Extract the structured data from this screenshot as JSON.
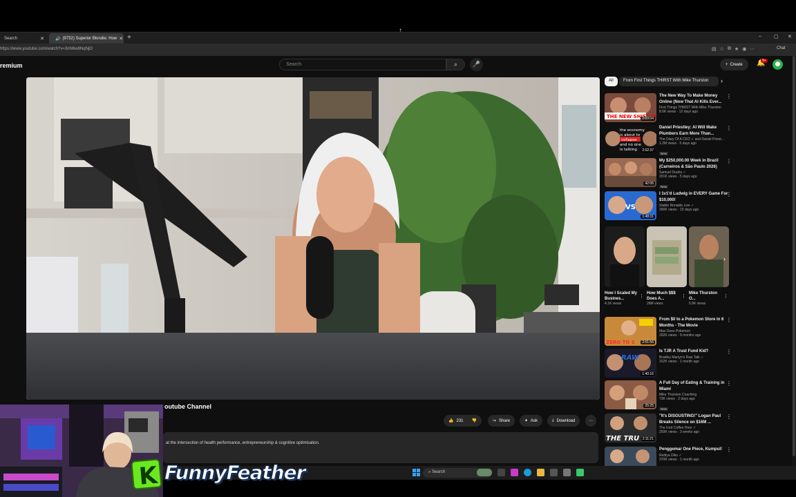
{
  "browser": {
    "tabs": [
      {
        "label": "Search"
      },
      {
        "label": "(9732) Superior Blondie: How"
      }
    ],
    "new_tab_glyph": "+",
    "url": "https://www.youtube.com/watch?v=3nN6w8NqNjO",
    "chat_label": "Chat",
    "window_controls": [
      "–",
      "▢",
      "✕"
    ]
  },
  "youtube": {
    "brand_fragment": "remium",
    "search_placeholder": "Search",
    "create_label": "Create",
    "notification_count": "9+",
    "video": {
      "title_fragment": "outube Channel",
      "actions": {
        "likes": "231",
        "share": "Share",
        "ask": "Ask",
        "download": "Download",
        "more": "⋯"
      },
      "description": "at the intersection of health performance, entrepreneurship & cognitive optimisation."
    },
    "sidebar": {
      "chips": {
        "all": "All",
        "from": "From First Things THIRST With Mike Thurston"
      },
      "videos_top": [
        {
          "title": "The New Way To Make Money Online (Now That AI Kills Ever...",
          "channel": "First Things THIRST With Mike Thurston",
          "stats": "8.6K views · 12 days ago",
          "duration": "2:09:04",
          "new": "",
          "thumb_text": "THE NEW SHIFT IS HE"
        },
        {
          "title": "Daniel Priestley: AI Will Make Plumbers Earn More Than...",
          "channel": "The Diary Of A CEO ✓ and Daniel Priest...",
          "stats": "1.2M views · 5 days ago",
          "duration": "2:02:37",
          "new": "New",
          "thumb_text": "the economy is about to collapse and no one is talking about it"
        },
        {
          "title": "My $250,000.00 Week in Brazil (Carneiros & São Paulo 2026)",
          "channel": "Samuel Douha ✓",
          "stats": "201K views · 5 days ago",
          "duration": "42:06",
          "new": "New",
          "thumb_text": ""
        },
        {
          "title": "I 1v1'd Ludwig in EVERY Game For $10,000!",
          "channel": "Stable Ronaldo Live ✓",
          "stats": "300K views · 10 days ago",
          "duration": "1:48:31",
          "new": "",
          "thumb_text": "VS"
        }
      ],
      "shorts": [
        {
          "title": "How I Scaled My Busines...",
          "views": "4.1K views"
        },
        {
          "title": "How Much $$$ Does A...",
          "views": "28M views"
        },
        {
          "title": "Mike Thurston O...",
          "views": "5.9K views"
        }
      ],
      "videos_bottom": [
        {
          "title": "From $0 to a Pokemon Store in 6 Months - The Movie",
          "channel": "Max Does Pokemon",
          "stats": "292K views · 9 months ago",
          "duration": "2:01:56",
          "new": "",
          "thumb_text": "ZERO TO S"
        },
        {
          "title": "Is TJR A Trust Fund Kid?",
          "channel": "Bradley Martyn's Raw Talk ✓",
          "stats": "152K views · 1 month ago",
          "duration": "1:40:16",
          "new": "",
          "thumb_text": "RAW TJR"
        },
        {
          "title": "A Full Day of Eating & Training in Miami",
          "channel": "Mike Thurston Coaching",
          "stats": "73K views · 2 days ago",
          "duration": "25:25",
          "new": "New",
          "thumb_text": ""
        },
        {
          "title": "\"It's DISGUSTING!\" Logan Paul Breaks Silence on $16M ...",
          "channel": "The Iced Coffee Hour ✓",
          "stats": "293K views · 3 weeks ago",
          "duration": "2:11:21",
          "new": "",
          "thumb_text": "THE TRU"
        },
        {
          "title": "Penggemar One Piece, Kumpul!",
          "channel": "Rediya Diko ✓",
          "stats": "370K views · 1 month ago",
          "duration": "",
          "new": "",
          "thumb_text": ""
        }
      ]
    }
  },
  "taskbar": {
    "search_label": "Search"
  },
  "overlay": {
    "logo_letter": "K",
    "streamer_name": "FunnyFeather"
  },
  "colors": {
    "accent_red": "#ff0000",
    "logo_green": "#6ae820",
    "chip_active": "#f1f1f1"
  }
}
